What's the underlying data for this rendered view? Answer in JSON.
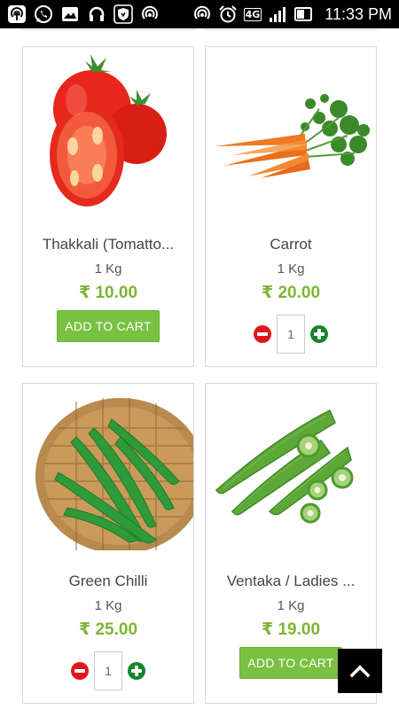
{
  "status_bar": {
    "time": "11:33 PM",
    "network": "4G",
    "icons": [
      "hotspot-icon",
      "whatsapp-icon",
      "gallery-icon",
      "headset-icon",
      "shield-icon",
      "hotspot-icon",
      "hotspot-icon",
      "alarm-icon",
      "signal-icon",
      "battery-icon"
    ]
  },
  "products": [
    {
      "name": "Thakkali (Tomatto...",
      "unit": "1 Kg",
      "price": "₹ 10.00",
      "action": "add",
      "add_label": "ADD TO CART",
      "image": "tomato"
    },
    {
      "name": "Carrot",
      "unit": "1 Kg",
      "price": "₹ 20.00",
      "action": "qty",
      "quantity": "1",
      "image": "carrot"
    },
    {
      "name": "Green Chilli",
      "unit": "1 Kg",
      "price": "₹ 25.00",
      "action": "qty",
      "quantity": "1",
      "image": "chilli"
    },
    {
      "name": "Ventaka / Ladies ...",
      "unit": "1 Kg",
      "price": "₹ 19.00",
      "action": "add",
      "add_label": "ADD TO CART",
      "image": "okra"
    }
  ],
  "colors": {
    "accent": "#7ac142",
    "price": "#7cb632",
    "minus": "#e0171b",
    "plus": "#16852a"
  }
}
